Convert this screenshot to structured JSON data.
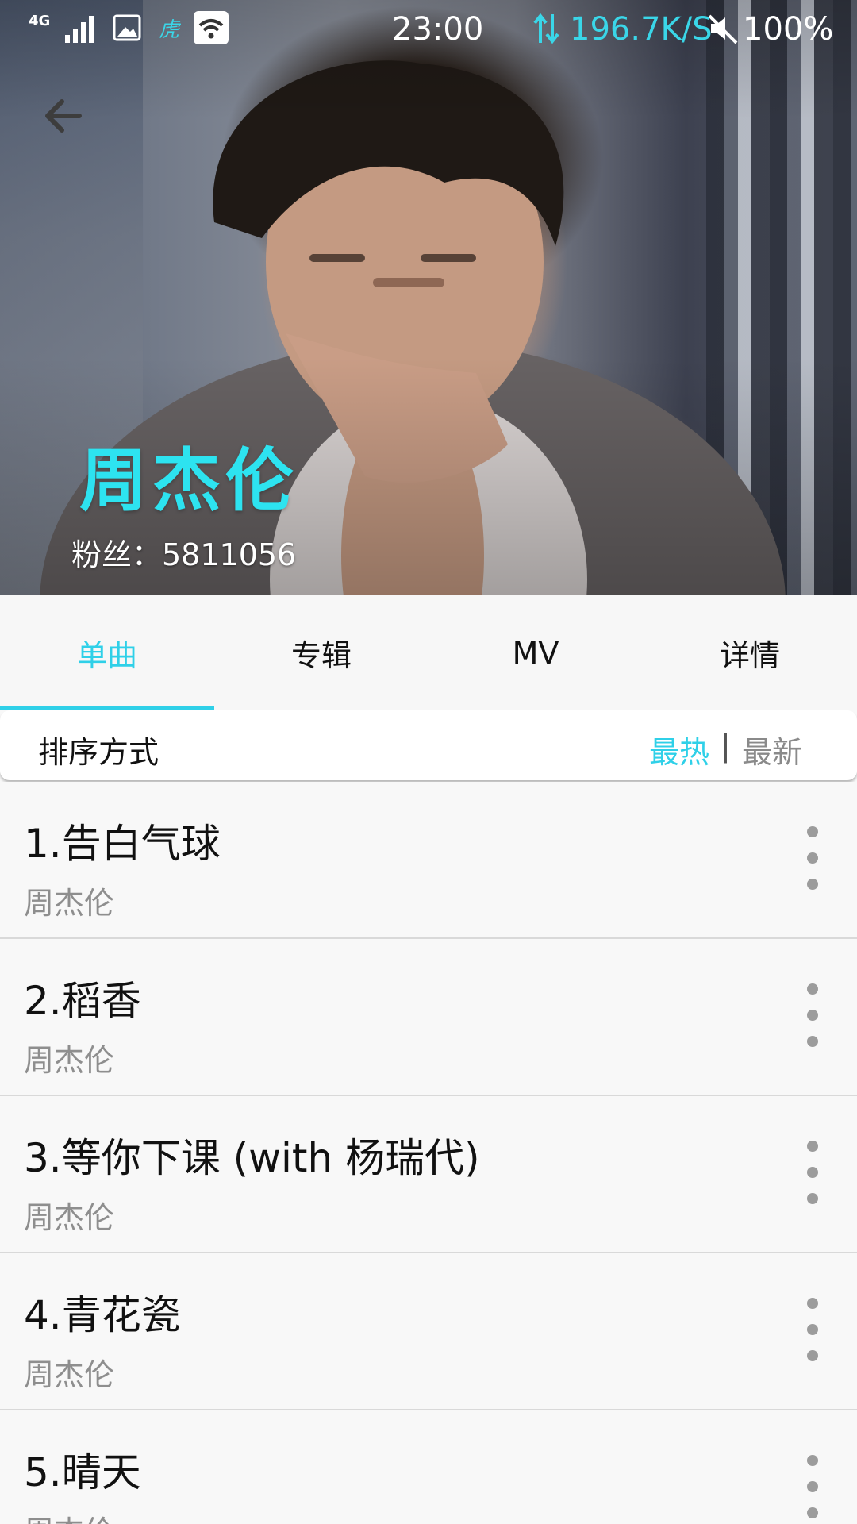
{
  "status_bar": {
    "network": "4G",
    "time": "23:00",
    "speed": "196.7K/S",
    "battery": "100%"
  },
  "header": {
    "artist_name": "周杰伦",
    "fans": "粉丝：5811056"
  },
  "tabs": [
    {
      "label": "单曲",
      "active": true
    },
    {
      "label": "专辑",
      "active": false
    },
    {
      "label": "MV",
      "active": false
    },
    {
      "label": "详情",
      "active": false
    }
  ],
  "sort": {
    "label": "排序方式",
    "hot": "最热",
    "separator": "|",
    "new": "最新"
  },
  "songs": [
    {
      "title": "1.告白气球",
      "artist": "周杰伦"
    },
    {
      "title": "2.稻香",
      "artist": "周杰伦"
    },
    {
      "title": "3.等你下课 (with 杨瑞代)",
      "artist": "周杰伦"
    },
    {
      "title": "4.青花瓷",
      "artist": "周杰伦"
    },
    {
      "title": "5.晴天",
      "artist": "周杰伦"
    }
  ],
  "colors": {
    "accent": "#2fd0e8",
    "artist_name": "#2de3f0"
  }
}
